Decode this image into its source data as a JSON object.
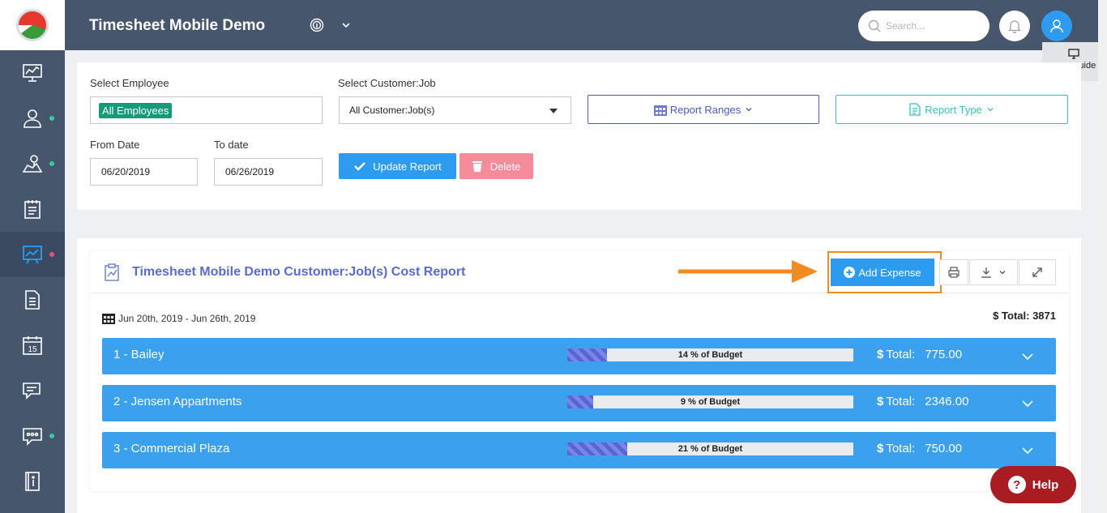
{
  "header": {
    "app_title": "Timesheet Mobile Demo",
    "search_placeholder": "Search...",
    "page_guide_label": "page guide"
  },
  "sidebar": {
    "items": [
      {
        "icon": "dashboard-chart-icon",
        "dot": false
      },
      {
        "icon": "users-icon",
        "dot": "green"
      },
      {
        "icon": "map-location-icon",
        "dot": "green"
      },
      {
        "icon": "timesheet-clipboard-icon",
        "dot": false
      },
      {
        "icon": "reports-presentation-icon",
        "dot": "red",
        "active": true
      },
      {
        "icon": "document-icon",
        "dot": false
      },
      {
        "icon": "calendar-icon",
        "dot": false,
        "text": "15"
      },
      {
        "icon": "messages-icon",
        "dot": false
      },
      {
        "icon": "chat-icon",
        "dot": "green"
      },
      {
        "icon": "info-book-icon",
        "dot": false
      }
    ]
  },
  "filters": {
    "employee_label": "Select Employee",
    "employee_value": "All Employees",
    "customer_label": "Select Customer:Job",
    "customer_value": "All Customer:Job(s)",
    "report_ranges_label": "Report Ranges",
    "report_type_label": "Report Type",
    "from_label": "From Date",
    "from_value": "06/20/2019",
    "to_label": "To date",
    "to_value": "06/26/2019",
    "update_label": "Update Report",
    "delete_label": "Delete"
  },
  "report": {
    "title": "Timesheet Mobile Demo Customer:Job(s) Cost Report",
    "add_expense_label": "Add Expense",
    "date_range": "Jun 20th, 2019 - Jun 26th, 2019",
    "total_label": "Total:",
    "total_value": "3871",
    "jobs": [
      {
        "name": "1 - Bailey",
        "budget_pct": 14,
        "budget_text": "14 % of Budget",
        "total_label": "Total:",
        "total": "775.00"
      },
      {
        "name": "2 - Jensen Appartments",
        "budget_pct": 9,
        "budget_text": "9 % of Budget",
        "total_label": "Total:",
        "total": "2346.00"
      },
      {
        "name": "3 - Commercial Plaza",
        "budget_pct": 21,
        "budget_text": "21 % of Budget",
        "total_label": "Total:",
        "total": "750.00"
      }
    ]
  },
  "help_label": "Help",
  "colors": {
    "sidebar_bg": "#45566d",
    "primary_blue": "#2d9cf0",
    "row_blue": "#3ba1ef",
    "highlight_orange": "#f28a22",
    "teal": "#169b7a",
    "delete_pink": "#f68b9a",
    "title_purple": "#5a6bd0",
    "help_red": "#a81c22"
  }
}
